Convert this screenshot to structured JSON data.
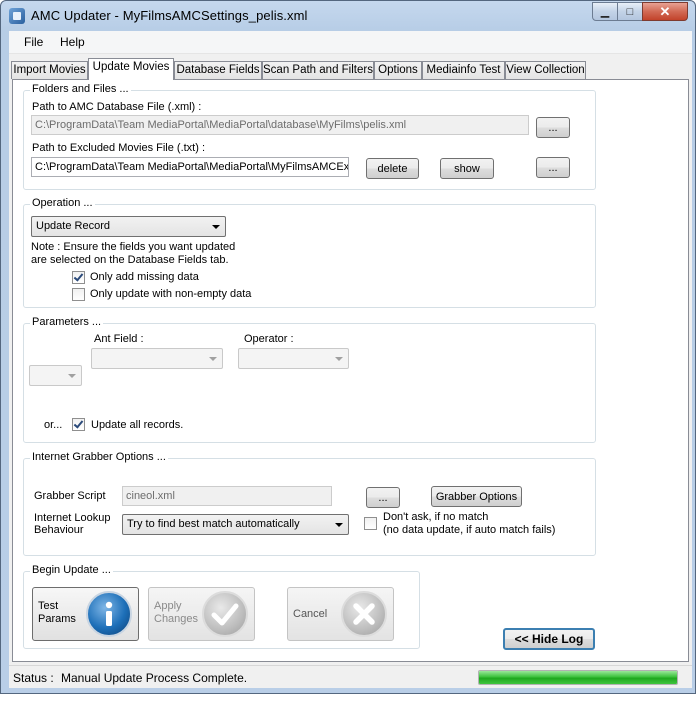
{
  "window": {
    "title": "AMC Updater - MyFilmsAMCSettings_pelis.xml",
    "min_glyph": "▁",
    "max_glyph": "□",
    "close_glyph": "✕"
  },
  "menu": {
    "items": [
      "File",
      "Help"
    ]
  },
  "tabs": [
    {
      "label": "Import Movies",
      "active": false
    },
    {
      "label": "Update Movies",
      "active": true
    },
    {
      "label": "Database Fields",
      "active": false
    },
    {
      "label": "Scan Path and Filters",
      "active": false
    },
    {
      "label": "Options",
      "active": false
    },
    {
      "label": "Mediainfo Test",
      "active": false
    },
    {
      "label": "View Collection",
      "active": false
    }
  ],
  "folders": {
    "title": "Folders and Files ...",
    "db_label": "Path to AMC Database File (.xml) :",
    "db_value": "C:\\ProgramData\\Team MediaPortal\\MediaPortal\\database\\MyFilms\\pelis.xml",
    "db_browse": "...",
    "excluded_label": "Path to Excluded Movies File (.txt) :",
    "excluded_value": "C:\\ProgramData\\Team MediaPortal\\MediaPortal\\MyFilmsAMCExc",
    "delete_label": "delete",
    "show_label": "show",
    "excluded_browse": "..."
  },
  "operation": {
    "title": "Operation ...",
    "selected": "Update Record",
    "note": "Note : Ensure the fields you want updated\nare selected on the Database Fields tab.",
    "only_missing_label": "Only add missing data",
    "only_missing_checked": true,
    "non_empty_label": "Only update with non-empty data",
    "non_empty_checked": false
  },
  "parameters": {
    "title": "Parameters ...",
    "ant_field_label": "Ant Field :",
    "operator_label": "Operator :",
    "or_label": "or...",
    "update_all_label": "Update all records.",
    "update_all_checked": true
  },
  "grabber": {
    "title": "Internet Grabber Options ...",
    "script_label": "Grabber Script",
    "script_value": "cineol.xml",
    "browse": "...",
    "options_button": "Grabber Options",
    "lookup_label": "Internet Lookup\nBehaviour",
    "lookup_selected": "Try to find best match automatically",
    "dont_ask_label": "Don't ask, if no match\n(no data update, if auto match fails)",
    "dont_ask_checked": false
  },
  "begin": {
    "title": "Begin Update ...",
    "test_label": "Test\nParams",
    "apply_label": "Apply\nChanges",
    "cancel_label": "Cancel",
    "test_icon": "info-icon",
    "apply_icon": "checkmark-icon",
    "cancel_icon": "cross-icon"
  },
  "hide_log_button": "<< Hide Log",
  "status": {
    "label": "Status :",
    "message": "Manual Update Process Complete.",
    "progress": 1.0
  },
  "colors": {
    "progress_green": "#2db82d",
    "accent_blue": "#1d6fb8",
    "hide_log_border": "#3c7fb1"
  }
}
